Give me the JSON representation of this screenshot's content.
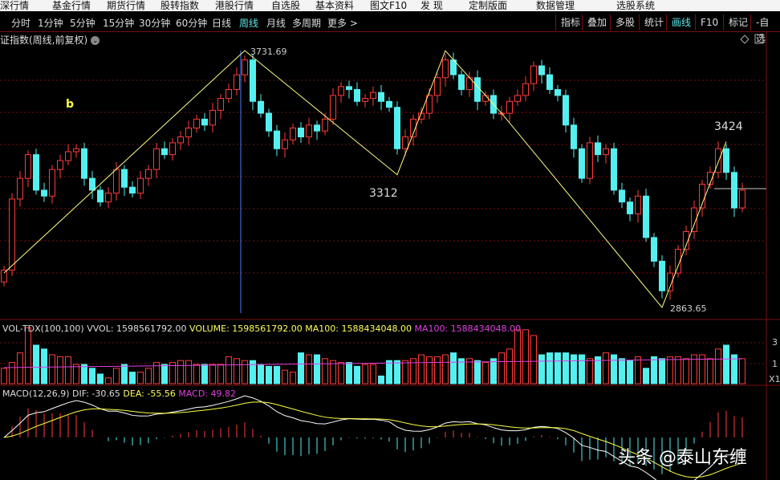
{
  "menu": [
    "沪深行情",
    "基金行情",
    "期货行情",
    "股转指数",
    "港股行情",
    "自选股",
    "基本资料",
    "图文F10",
    "发  现",
    "定制版面",
    "数据管理",
    "选股系统"
  ],
  "periods": [
    "分时",
    "1分钟",
    "5分钟",
    "15分钟",
    "30分钟",
    "60分钟",
    "日线",
    "周线",
    "月线",
    "多周期",
    "更多 >"
  ],
  "active_period": "周线",
  "right_buttons": [
    "指标",
    "叠加",
    "多股",
    "统计",
    "画线",
    "F10",
    "标记",
    "-自选"
  ],
  "active_button": "画线",
  "title": "证指数(周线,前复权)",
  "colors": {
    "up": "#ff3b3b",
    "down": "#54f0f0",
    "zigzag": "#ffff88",
    "ma": "#e040e0",
    "grid": "#7a1010"
  },
  "annotations": {
    "b": "b",
    "high1": "3731.69",
    "low1": "3312",
    "low2": "2863.65",
    "high2": "3424"
  },
  "volume_header": {
    "name": "VOL-TDX(100,100)",
    "vvol": "VVOL: 1598561792.00",
    "volume": "VOLUME: 1598561792.00",
    "ma1": "MA100: 1588434048.00",
    "ma2": "MA100: 1588434048.00"
  },
  "macd_header": {
    "name": "MACD(12,26,9)",
    "dif": "DIF: -30.65",
    "dea": "DEA: -55.56",
    "macd": "MACD: 49.82"
  },
  "axis": {
    "vol_top": "3",
    "vol_mid": "1",
    "vol_unit": "X1"
  },
  "watermark": "头条 @泰山东缠",
  "chart_data": {
    "type": "candlestick",
    "period": "weekly",
    "price_range": [
      2863.65,
      3731.69
    ],
    "closes": [
      2990,
      3230,
      3300,
      3380,
      3260,
      3240,
      3330,
      3360,
      3390,
      3400,
      3300,
      3260,
      3220,
      3250,
      3330,
      3270,
      3250,
      3300,
      3330,
      3400,
      3380,
      3420,
      3440,
      3470,
      3500,
      3480,
      3530,
      3570,
      3600,
      3650,
      3700,
      3560,
      3520,
      3460,
      3400,
      3430,
      3470,
      3440,
      3480,
      3460,
      3500,
      3580,
      3610,
      3600,
      3560,
      3570,
      3590,
      3560,
      3540,
      3400,
      3440,
      3500,
      3520,
      3580,
      3640,
      3700,
      3650,
      3600,
      3640,
      3560,
      3580,
      3520,
      3520,
      3560,
      3580,
      3620,
      3680,
      3650,
      3600,
      3580,
      3480,
      3400,
      3300,
      3420,
      3380,
      3400,
      3260,
      3220,
      3180,
      3240,
      3100,
      3020,
      2920,
      2980,
      3060,
      3120,
      3200,
      3280,
      3320,
      3400,
      3320,
      3200,
      3260
    ],
    "volume_relative": [
      0.8,
      1.1,
      1.6,
      2.9,
      2.0,
      1.8,
      1.5,
      1.4,
      1.4,
      1.0,
      1.0,
      0.8,
      0.5,
      0.3,
      0.8,
      1.0,
      0.6,
      0.6,
      0.8,
      1.1,
      1.0,
      1.1,
      1.2,
      1.2,
      1.0,
      1.0,
      1.0,
      1.0,
      1.4,
      1.3,
      1.2,
      1.2,
      1.0,
      0.9,
      0.9,
      0.7,
      0.6,
      1.6,
      1.5,
      1.5,
      1.3,
      1.2,
      1.1,
      1.1,
      0.9,
      1.0,
      1.0,
      0.4,
      1.2,
      1.2,
      1.2,
      1.3,
      1.5,
      1.4,
      1.4,
      1.5,
      1.6,
      1.3,
      1.3,
      1.2,
      1.1,
      1.3,
      1.6,
      1.8,
      2.8,
      2.8,
      2.5,
      1.5,
      1.6,
      1.6,
      1.6,
      1.5,
      1.5,
      1.3,
      1.4,
      1.6,
      1.5,
      1.3,
      1.2,
      1.4,
      0.8,
      1.4,
      1.3,
      1.4,
      1.4,
      1.3,
      1.5,
      1.5,
      1.3,
      1.8,
      2.0,
      1.5,
      1.3
    ],
    "zigzag": [
      [
        0,
        2980
      ],
      [
        30,
        3731.69
      ],
      [
        49,
        3312
      ],
      [
        55,
        3731
      ],
      [
        62,
        3520
      ],
      [
        82,
        2863.65
      ],
      [
        90,
        3424
      ]
    ]
  }
}
